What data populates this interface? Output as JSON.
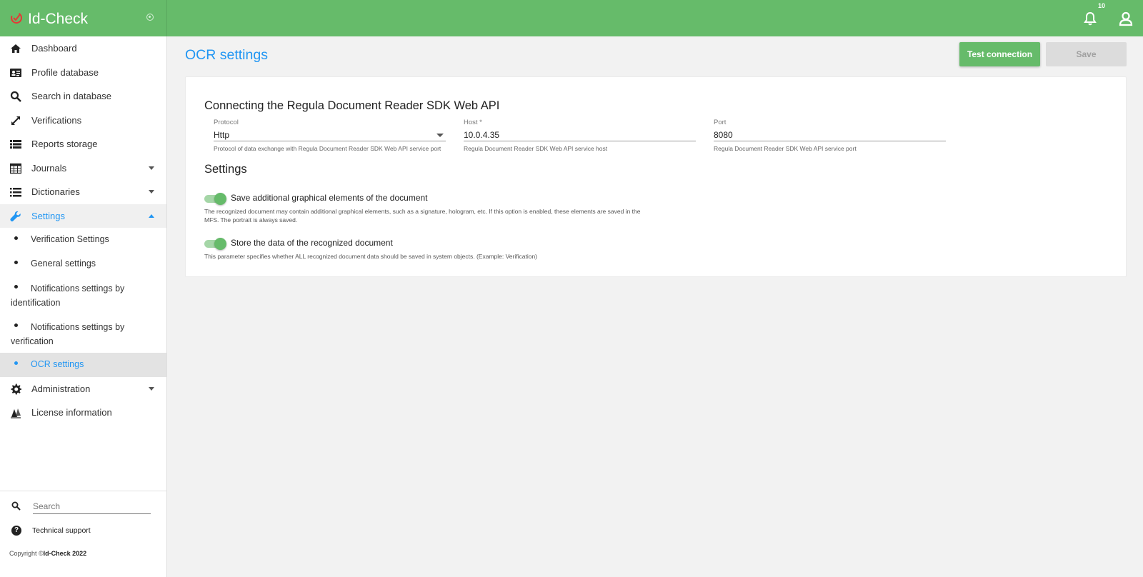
{
  "app": {
    "title": "Id-Check",
    "notifications_count": "10"
  },
  "sidebar": {
    "items": [
      {
        "label": "Dashboard",
        "icon": "home-icon"
      },
      {
        "label": "Profile database",
        "icon": "id-card-icon"
      },
      {
        "label": "Search in database",
        "icon": "search-icon"
      },
      {
        "label": "Verifications",
        "icon": "expand-arrows-icon"
      },
      {
        "label": "Reports storage",
        "icon": "list-icon"
      },
      {
        "label": "Journals",
        "icon": "table-icon"
      },
      {
        "label": "Dictionaries",
        "icon": "bullet-list-icon"
      },
      {
        "label": "Settings",
        "icon": "wrench-icon"
      },
      {
        "label": "Administration",
        "icon": "gear-icon"
      },
      {
        "label": "License information",
        "icon": "license-icon"
      }
    ],
    "settings_sub": [
      {
        "label": "Verification Settings"
      },
      {
        "label": "General settings"
      },
      {
        "label": "Notifications settings by identification"
      },
      {
        "label": "Notifications settings by verification"
      },
      {
        "label": "OCR settings"
      }
    ],
    "search_placeholder": "Search",
    "support_label": "Technical support",
    "copyright_prefix": "Copyright ©",
    "copyright_brand": "Id-Check 2022"
  },
  "main": {
    "page_title": "OCR settings",
    "test_button": "Test connection",
    "save_button": "Save",
    "connection_heading": "Connecting the Regula Document Reader SDK Web API",
    "protocol": {
      "label": "Protocol",
      "value": "Http",
      "help": "Protocol of data exchange with Regula Document Reader SDK Web API service port"
    },
    "host": {
      "label": "Host *",
      "value": "10.0.4.35",
      "help": "Regula Document Reader SDK Web API service host"
    },
    "port": {
      "label": "Port",
      "value": "8080",
      "help": "Regula Document Reader SDK Web API service port"
    },
    "settings_heading": "Settings",
    "toggle1": {
      "label": "Save additional graphical elements of the document",
      "help": "The recognized document may contain additional graphical elements, such as a signature, hologram, etc. If this option is enabled, these elements are saved in the MFS. The portrait is always saved.",
      "on": true
    },
    "toggle2": {
      "label": "Store the data of the recognized document",
      "help": "This parameter specifies whether ALL recognized document data should be saved in system objects. (Example: Verification)",
      "on": true
    }
  },
  "colors": {
    "brand_green": "#66bb6a",
    "accent_blue": "#2196f3",
    "logo_red": "#e53935"
  }
}
